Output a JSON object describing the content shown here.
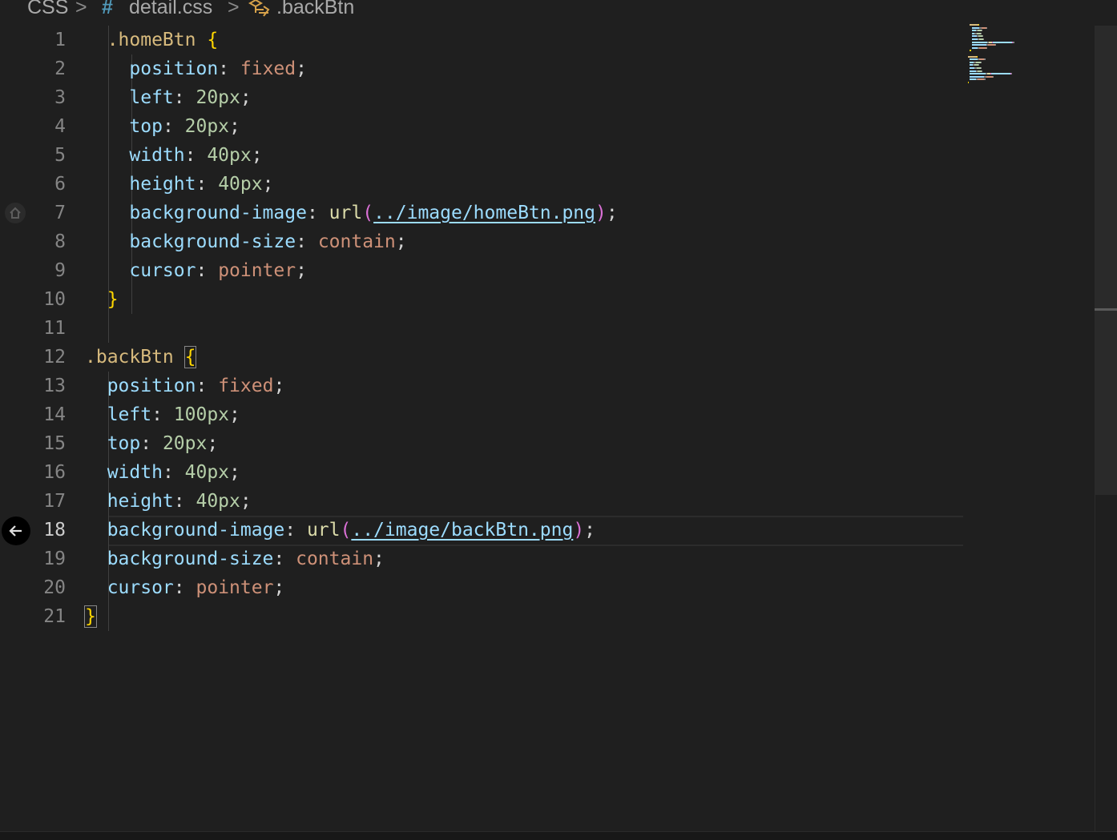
{
  "breadcrumb": {
    "folder": "CSS",
    "separator": ">",
    "file_icon": "hash-icon",
    "file": "detail.css",
    "symbol_icon": "css-selector-icon",
    "symbol": ".backBtn"
  },
  "editor": {
    "active_line": 18,
    "line_numbers": [
      "1",
      "2",
      "3",
      "4",
      "5",
      "6",
      "7",
      "8",
      "9",
      "10",
      "11",
      "12",
      "13",
      "14",
      "15",
      "16",
      "17",
      "18",
      "19",
      "20",
      "21"
    ],
    "gutter_icons": [
      {
        "line": 7,
        "icon": "home-icon"
      },
      {
        "line": 18,
        "icon": "back-arrow-icon"
      }
    ],
    "lines": [
      [
        {
          "t": "sel",
          "v": "  .homeBtn "
        },
        {
          "t": "brace",
          "v": "{"
        }
      ],
      [
        {
          "t": "prop",
          "v": "    position"
        },
        {
          "t": "punc",
          "v": ": "
        },
        {
          "t": "val",
          "v": "fixed"
        },
        {
          "t": "punc",
          "v": ";"
        }
      ],
      [
        {
          "t": "prop",
          "v": "    left"
        },
        {
          "t": "punc",
          "v": ": "
        },
        {
          "t": "num",
          "v": "20px"
        },
        {
          "t": "punc",
          "v": ";"
        }
      ],
      [
        {
          "t": "prop",
          "v": "    top"
        },
        {
          "t": "punc",
          "v": ": "
        },
        {
          "t": "num",
          "v": "20px"
        },
        {
          "t": "punc",
          "v": ";"
        }
      ],
      [
        {
          "t": "prop",
          "v": "    width"
        },
        {
          "t": "punc",
          "v": ": "
        },
        {
          "t": "num",
          "v": "40px"
        },
        {
          "t": "punc",
          "v": ";"
        }
      ],
      [
        {
          "t": "prop",
          "v": "    height"
        },
        {
          "t": "punc",
          "v": ": "
        },
        {
          "t": "num",
          "v": "40px"
        },
        {
          "t": "punc",
          "v": ";"
        }
      ],
      [
        {
          "t": "prop",
          "v": "    background-image"
        },
        {
          "t": "punc",
          "v": ": "
        },
        {
          "t": "fn",
          "v": "url"
        },
        {
          "t": "paren",
          "v": "("
        },
        {
          "t": "url",
          "v": "../image/homeBtn.png"
        },
        {
          "t": "paren",
          "v": ")"
        },
        {
          "t": "punc",
          "v": ";"
        }
      ],
      [
        {
          "t": "prop",
          "v": "    background-size"
        },
        {
          "t": "punc",
          "v": ": "
        },
        {
          "t": "val",
          "v": "contain"
        },
        {
          "t": "punc",
          "v": ";"
        }
      ],
      [
        {
          "t": "prop",
          "v": "    cursor"
        },
        {
          "t": "punc",
          "v": ": "
        },
        {
          "t": "val",
          "v": "pointer"
        },
        {
          "t": "punc",
          "v": ";"
        }
      ],
      [
        {
          "t": "brace",
          "v": "  }"
        }
      ],
      [],
      [
        {
          "t": "sel",
          "v": ".backBtn "
        },
        {
          "t": "brace-box",
          "v": "{"
        }
      ],
      [
        {
          "t": "prop",
          "v": "  position"
        },
        {
          "t": "punc",
          "v": ": "
        },
        {
          "t": "val",
          "v": "fixed"
        },
        {
          "t": "punc",
          "v": ";"
        }
      ],
      [
        {
          "t": "prop",
          "v": "  left"
        },
        {
          "t": "punc",
          "v": ": "
        },
        {
          "t": "num",
          "v": "100px"
        },
        {
          "t": "punc",
          "v": ";"
        }
      ],
      [
        {
          "t": "prop",
          "v": "  top"
        },
        {
          "t": "punc",
          "v": ": "
        },
        {
          "t": "num",
          "v": "20px"
        },
        {
          "t": "punc",
          "v": ";"
        }
      ],
      [
        {
          "t": "prop",
          "v": "  width"
        },
        {
          "t": "punc",
          "v": ": "
        },
        {
          "t": "num",
          "v": "40px"
        },
        {
          "t": "punc",
          "v": ";"
        }
      ],
      [
        {
          "t": "prop",
          "v": "  height"
        },
        {
          "t": "punc",
          "v": ": "
        },
        {
          "t": "num",
          "v": "40px"
        },
        {
          "t": "punc",
          "v": ";"
        }
      ],
      [
        {
          "t": "prop",
          "v": "  background-image"
        },
        {
          "t": "punc",
          "v": ": "
        },
        {
          "t": "fn",
          "v": "url"
        },
        {
          "t": "paren",
          "v": "("
        },
        {
          "t": "url",
          "v": "../image/backBtn.png"
        },
        {
          "t": "paren",
          "v": ")"
        },
        {
          "t": "punc",
          "v": ";"
        }
      ],
      [
        {
          "t": "prop",
          "v": "  background-size"
        },
        {
          "t": "punc",
          "v": ": "
        },
        {
          "t": "val",
          "v": "contain"
        },
        {
          "t": "punc",
          "v": ";"
        }
      ],
      [
        {
          "t": "prop",
          "v": "  cursor"
        },
        {
          "t": "punc",
          "v": ": "
        },
        {
          "t": "val",
          "v": "pointer"
        },
        {
          "t": "punc",
          "v": ";"
        }
      ],
      [
        {
          "t": "brace-box",
          "v": "}"
        }
      ]
    ]
  },
  "colors": {
    "background": "#1f1f1f",
    "selector": "#d7ba7d",
    "property": "#9cdcfe",
    "value": "#ce9178",
    "number": "#b5cea8",
    "brace": "#ffd700"
  }
}
